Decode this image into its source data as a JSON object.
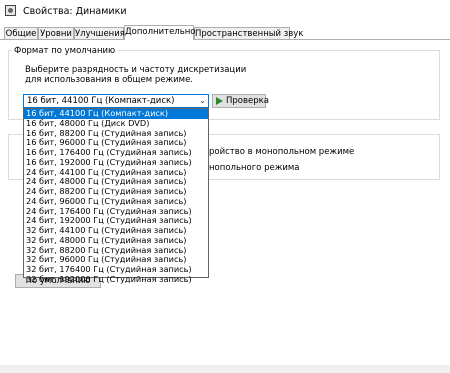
{
  "window": {
    "title": "Свойства: Динамики"
  },
  "tabs": [
    {
      "label": "Общие"
    },
    {
      "label": "Уровни"
    },
    {
      "label": "Улучшения"
    },
    {
      "label": "Дополнительно"
    },
    {
      "label": "Пространственный звук"
    }
  ],
  "default_format": {
    "group_label": "Формат по умолчанию",
    "description": "Выберите разрядность и частоту дискретизации для использования в общем режиме.",
    "combo_value": "16 бит, 44100 Гц (Компакт-диск)",
    "check_button": "Проверка"
  },
  "exclusive": {
    "option1_partial": "ройство в монопольном режиме",
    "option2_partial": "нопольного режима"
  },
  "default_button": "По умолчанию",
  "dropdown": {
    "selected_index": 0,
    "items": [
      "16 бит, 44100 Гц (Компакт-диск)",
      "16 бит, 48000 Гц (Диск DVD)",
      "16 бит, 88200 Гц (Студийная запись)",
      "16 бит, 96000 Гц (Студийная запись)",
      "16 бит, 176400 Гц (Студийная запись)",
      "16 бит, 192000 Гц (Студийная запись)",
      "24 бит, 44100 Гц (Студийная запись)",
      "24 бит, 48000 Гц (Студийная запись)",
      "24 бит, 88200 Гц (Студийная запись)",
      "24 бит, 96000 Гц (Студийная запись)",
      "24 бит, 176400 Гц (Студийная запись)",
      "24 бит, 192000 Гц (Студийная запись)",
      "32 бит, 44100 Гц (Студийная запись)",
      "32 бит, 48000 Гц (Студийная запись)",
      "32 бит, 88200 Гц (Студийная запись)",
      "32 бит, 96000 Гц (Студийная запись)",
      "32 бит, 176400 Гц (Студийная запись)",
      "32 бит, 192000 Гц (Студийная запись)"
    ]
  },
  "icons": {
    "app": "speaker-properties-icon",
    "combo_arrow": "chevron-down-icon",
    "check": "play-icon"
  },
  "colors": {
    "accent": "#0078d7",
    "play_green": "#2a8a2a"
  }
}
